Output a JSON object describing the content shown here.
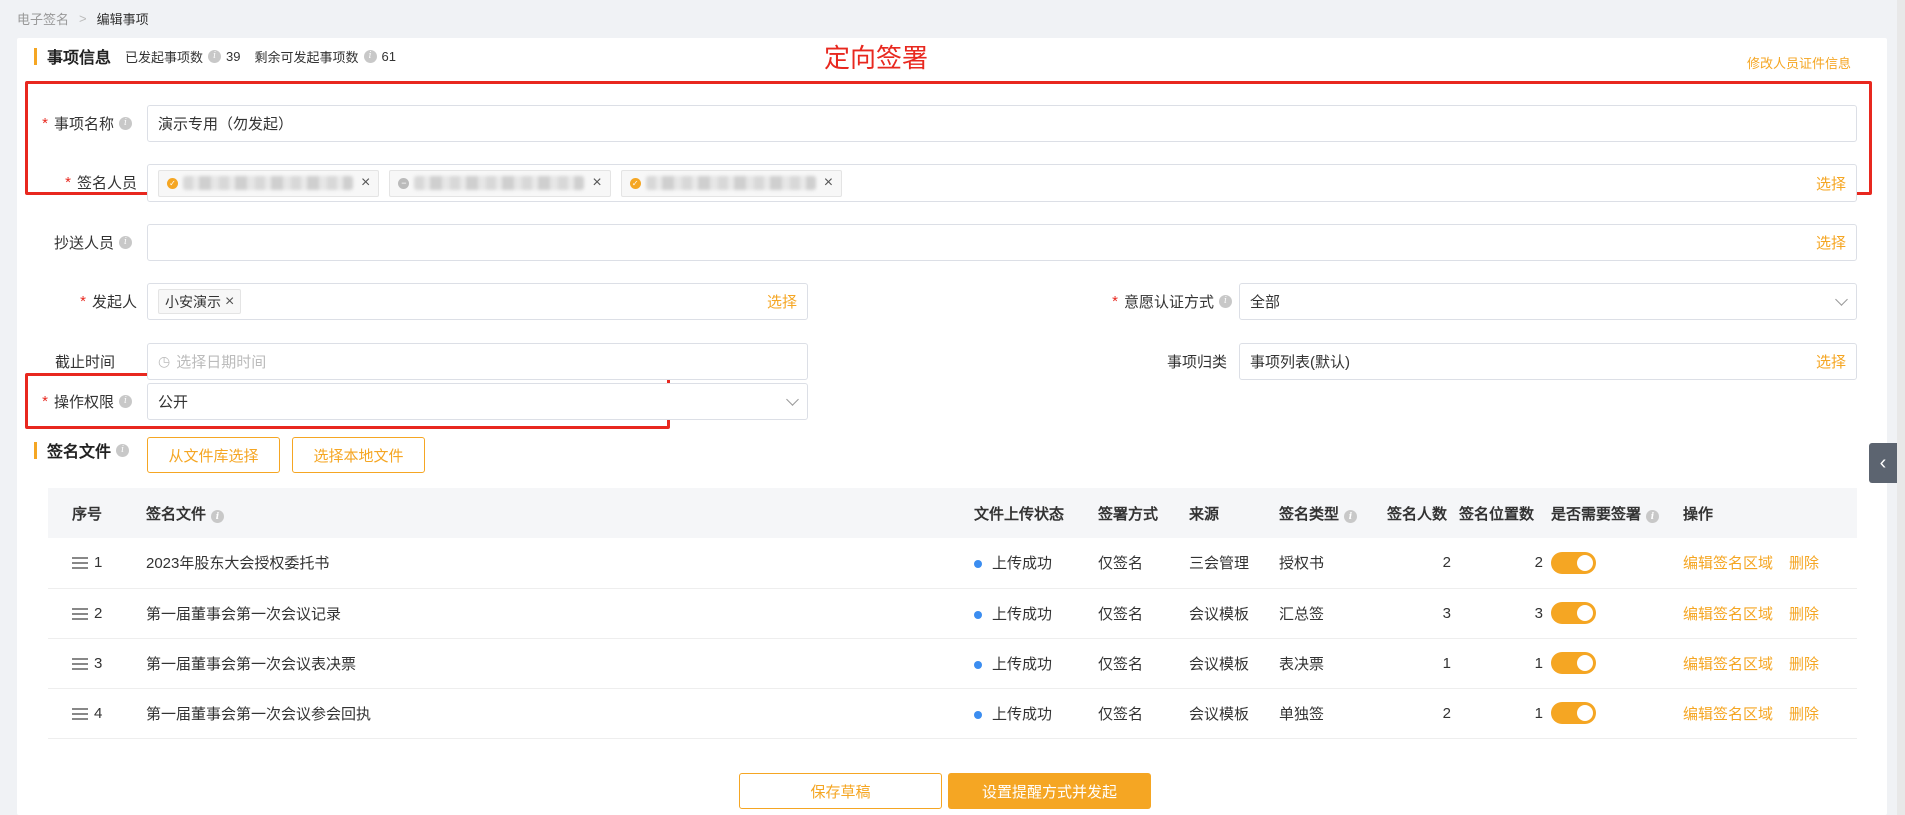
{
  "breadcrumb": {
    "root": "电子签名",
    "sep": ">",
    "current": "编辑事项"
  },
  "annotation": "定向签署",
  "info": {
    "title": "事项信息",
    "started_label": "已发起事项数",
    "started_count": "39",
    "remaining_label": "剩余可发起事项数",
    "remaining_count": "61",
    "edit_link": "修改人员证件信息"
  },
  "form": {
    "item_name": {
      "label": "事项名称",
      "value": "演示专用（勿发起）"
    },
    "signers": {
      "label": "签名人员",
      "select": "选择"
    },
    "cc": {
      "label": "抄送人员",
      "select": "选择"
    },
    "initiator": {
      "label": "发起人",
      "tag": "小安演示",
      "select": "选择"
    },
    "auth_method": {
      "label": "意愿认证方式",
      "value": "全部"
    },
    "deadline": {
      "label": "截止时间",
      "placeholder": "选择日期时间"
    },
    "category": {
      "label": "事项归类",
      "value": "事项列表(默认)",
      "select": "选择"
    },
    "permission": {
      "label": "操作权限",
      "value": "公开"
    }
  },
  "files": {
    "title": "签名文件",
    "btn_library": "从文件库选择",
    "btn_local": "选择本地文件",
    "columns": [
      "序号",
      "签名文件",
      "文件上传状态",
      "签署方式",
      "来源",
      "签名类型",
      "签名人数",
      "签名位置数",
      "是否需要签署",
      "操作"
    ],
    "rows": [
      {
        "no": "1",
        "name": "2023年股东大会授权委托书",
        "status": "上传成功",
        "method": "仅签名",
        "source": "三会管理",
        "type": "授权书",
        "signers": "2",
        "positions": "2"
      },
      {
        "no": "2",
        "name": "第一届董事会第一次会议记录",
        "status": "上传成功",
        "method": "仅签名",
        "source": "会议模板",
        "type": "汇总签",
        "signers": "3",
        "positions": "3"
      },
      {
        "no": "3",
        "name": "第一届董事会第一次会议表决票",
        "status": "上传成功",
        "method": "仅签名",
        "source": "会议模板",
        "type": "表决票",
        "signers": "1",
        "positions": "1"
      },
      {
        "no": "4",
        "name": "第一届董事会第一次会议参会回执",
        "status": "上传成功",
        "method": "仅签名",
        "source": "会议模板",
        "type": "单独签",
        "signers": "2",
        "positions": "1"
      }
    ],
    "op_edit": "编辑签名区域",
    "op_delete": "删除"
  },
  "footer": {
    "save_draft": "保存草稿",
    "submit": "设置提醒方式并发起"
  },
  "colors": {
    "accent": "#f5a623",
    "annotation": "#e8281f",
    "status": "#3b8df0"
  }
}
